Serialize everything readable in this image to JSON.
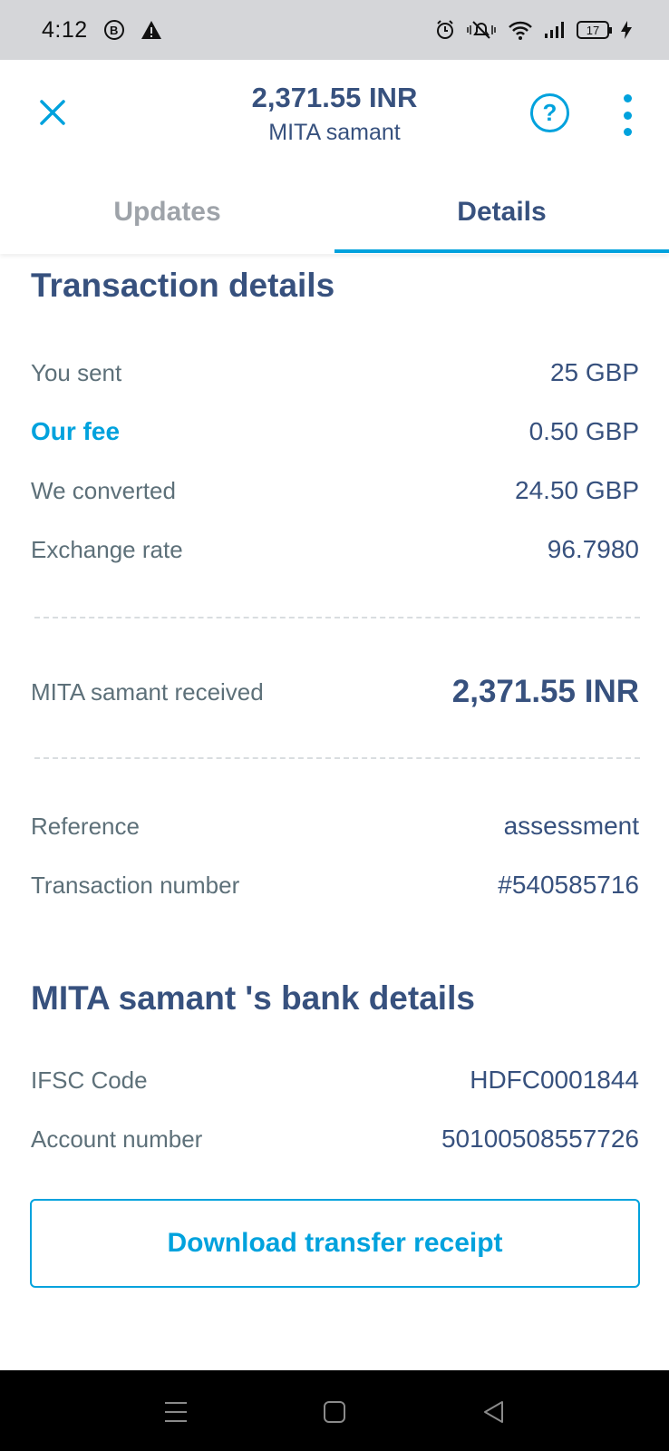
{
  "status_bar": {
    "time": "4:12",
    "badge": "B",
    "battery": "17",
    "icons": [
      "b-circle-icon",
      "warning-icon",
      "alarm-icon",
      "mute-icon",
      "wifi-icon",
      "signal-icon",
      "battery-icon",
      "charging-icon"
    ]
  },
  "header": {
    "amount": "2,371.55 INR",
    "recipient": "MITA samant",
    "help_icon": "?"
  },
  "tabs": [
    {
      "label": "Updates",
      "active": false
    },
    {
      "label": "Details",
      "active": true
    }
  ],
  "transaction": {
    "title": "Transaction details",
    "rows": [
      {
        "label": "You sent",
        "value": "25 GBP"
      },
      {
        "label": "Our fee",
        "value": "0.50 GBP"
      },
      {
        "label": "We converted",
        "value": "24.50 GBP"
      },
      {
        "label": "Exchange rate",
        "value": "96.7980"
      }
    ],
    "received_label": "MITA samant  received",
    "received_value": "2,371.55 INR",
    "reference_label": "Reference",
    "reference_value": "assessment",
    "number_label": "Transaction number",
    "number_value": "#540585716"
  },
  "bank": {
    "title": "MITA samant 's bank details",
    "ifsc_label": "IFSC Code",
    "ifsc_value": "HDFC0001844",
    "account_label": "Account number",
    "account_value": "50100508557726"
  },
  "actions": {
    "download_label": "Download transfer receipt"
  },
  "colors": {
    "accent": "#00a2dd",
    "text_primary": "#37517e",
    "text_secondary": "#5d7079",
    "tab_inactive": "#9ea3a9"
  }
}
